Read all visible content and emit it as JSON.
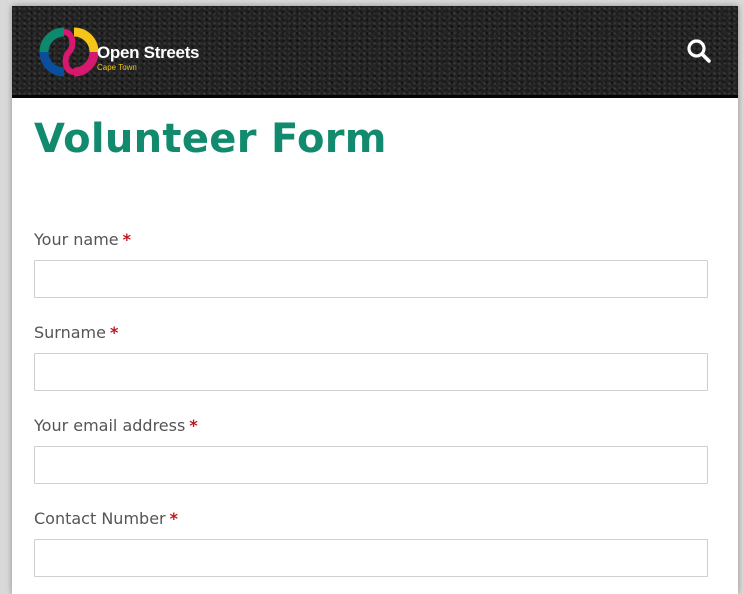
{
  "header": {
    "brand_title": "Open Streets",
    "brand_subtitle": "Cape Town",
    "logo_icon": "open-streets-logo-icon",
    "search_icon": "search-icon"
  },
  "page": {
    "title": "Volunteer Form"
  },
  "form": {
    "required_marker": "*",
    "fields": [
      {
        "label": "Your name",
        "value": "",
        "placeholder": ""
      },
      {
        "label": "Surname",
        "value": "",
        "placeholder": ""
      },
      {
        "label": "Your email address",
        "value": "",
        "placeholder": ""
      },
      {
        "label": "Contact Number",
        "value": "",
        "placeholder": ""
      }
    ]
  },
  "colors": {
    "title_green": "#128a6e",
    "required_red": "#c0161b",
    "header_dark": "#1f1f1f",
    "logo_teal": "#0d8a6e",
    "logo_blue": "#0a4f9c",
    "logo_yellow": "#f5c518",
    "logo_magenta": "#d6186f"
  }
}
